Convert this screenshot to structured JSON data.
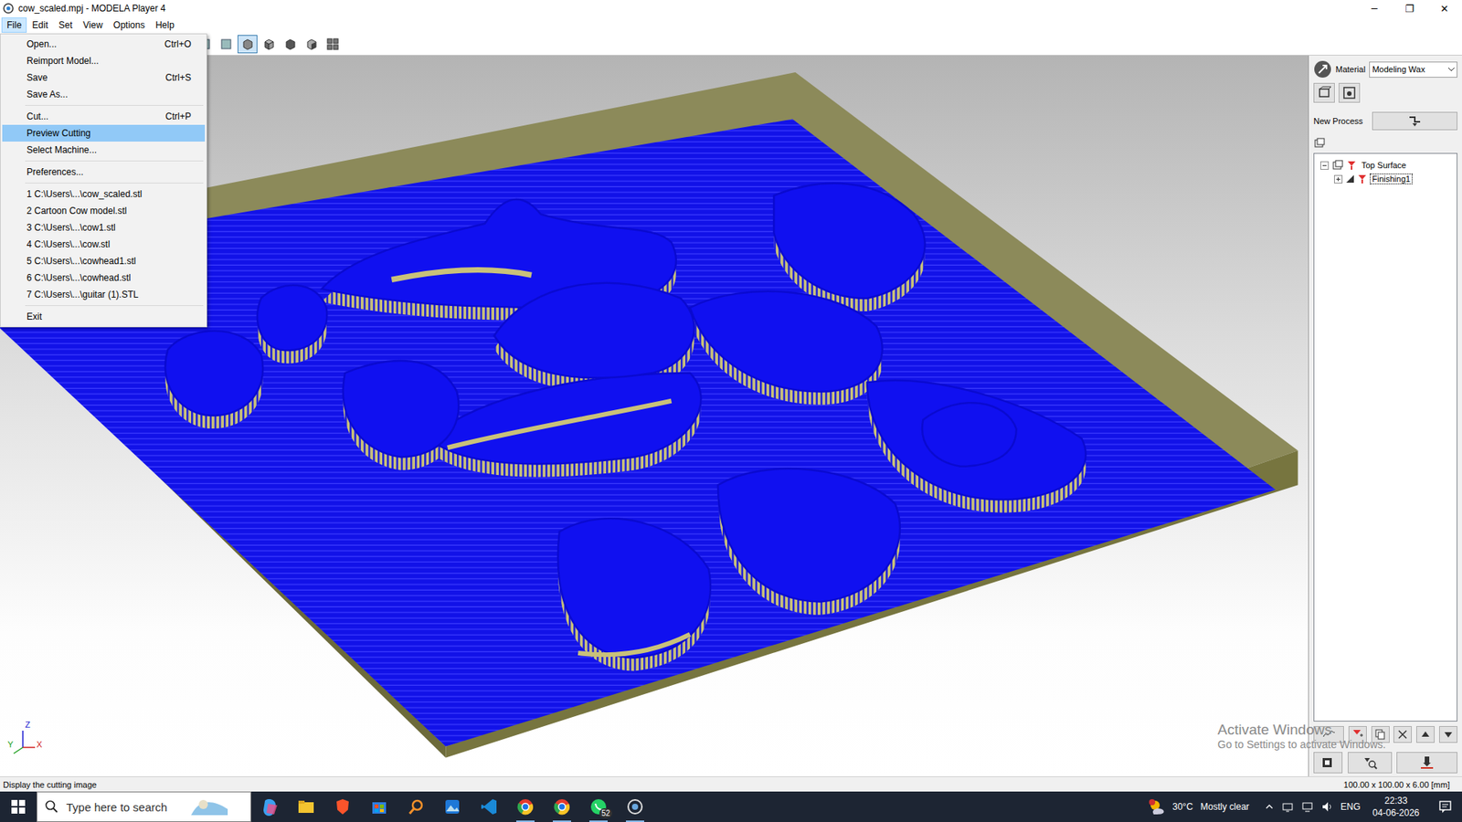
{
  "window": {
    "title": "cow_scaled.mpj - MODELA Player 4",
    "controls": [
      "─",
      "❐",
      "✕"
    ]
  },
  "menu_bar": [
    {
      "label": "File",
      "selected": true
    },
    {
      "label": "Edit",
      "selected": false
    },
    {
      "label": "Set",
      "selected": false
    },
    {
      "label": "View",
      "selected": false
    },
    {
      "label": "Options",
      "selected": false
    },
    {
      "label": "Help",
      "selected": false
    }
  ],
  "file_menu": [
    {
      "kind": "item",
      "label": "Open...",
      "shortcut": "Ctrl+O",
      "selected": false
    },
    {
      "kind": "item",
      "label": "Reimport Model...",
      "shortcut": "",
      "selected": false
    },
    {
      "kind": "item",
      "label": "Save",
      "shortcut": "Ctrl+S",
      "selected": false
    },
    {
      "kind": "item",
      "label": "Save As...",
      "shortcut": "",
      "selected": false
    },
    {
      "kind": "separator"
    },
    {
      "kind": "item",
      "label": "Cut...",
      "shortcut": "Ctrl+P",
      "selected": false
    },
    {
      "kind": "item",
      "label": "Preview Cutting",
      "shortcut": "",
      "selected": true
    },
    {
      "kind": "item",
      "label": "Select Machine...",
      "shortcut": "",
      "selected": false
    },
    {
      "kind": "separator"
    },
    {
      "kind": "item",
      "label": "Preferences...",
      "shortcut": "",
      "selected": false
    },
    {
      "kind": "separator"
    },
    {
      "kind": "item",
      "label": "1 C:\\Users\\...\\cow_scaled.stl",
      "shortcut": "",
      "selected": false
    },
    {
      "kind": "item",
      "label": "2 Cartoon Cow model.stl",
      "shortcut": "",
      "selected": false
    },
    {
      "kind": "item",
      "label": "3 C:\\Users\\...\\cow1.stl",
      "shortcut": "",
      "selected": false
    },
    {
      "kind": "item",
      "label": "4 C:\\Users\\...\\cow.stl",
      "shortcut": "",
      "selected": false
    },
    {
      "kind": "item",
      "label": "5 C:\\Users\\...\\cowhead1.stl",
      "shortcut": "",
      "selected": false
    },
    {
      "kind": "item",
      "label": "6 C:\\Users\\...\\cowhead.stl",
      "shortcut": "",
      "selected": false
    },
    {
      "kind": "item",
      "label": "7 C:\\Users\\...\\guitar (1).STL",
      "shortcut": "",
      "selected": false
    },
    {
      "kind": "separator"
    },
    {
      "kind": "item",
      "label": "Exit",
      "shortcut": "",
      "selected": false
    }
  ],
  "toolbar": {
    "view_buttons": [
      {
        "selected": true
      },
      {
        "selected": false
      },
      {
        "selected": false
      },
      {
        "selected": false
      },
      {
        "selected": false
      }
    ]
  },
  "viewport": {
    "axes": [
      "Z",
      "Y",
      "X"
    ]
  },
  "right_panel": {
    "material_label": "Material",
    "material_value": "Modeling Wax",
    "new_process_label": "New Process",
    "tree": [
      {
        "label": "Top Surface",
        "expanded": true,
        "selected": false,
        "children": [
          {
            "label": "Finishing1",
            "expanded": false,
            "selected": true
          }
        ]
      }
    ]
  },
  "watermark": {
    "title": "Activate Windows",
    "subtitle": "Go to Settings to activate Windows."
  },
  "status_bar": {
    "hint": "Display the cutting image",
    "dimensions": "100.00 x 100.00 x 6.00 [mm]"
  },
  "taskbar": {
    "search_placeholder": "Type here to search",
    "whatsapp_badge": "52",
    "weather_temp": "30°C",
    "weather_text": "Mostly clear",
    "language": "ENG",
    "time": "22:33",
    "date": "04-06-2026"
  }
}
